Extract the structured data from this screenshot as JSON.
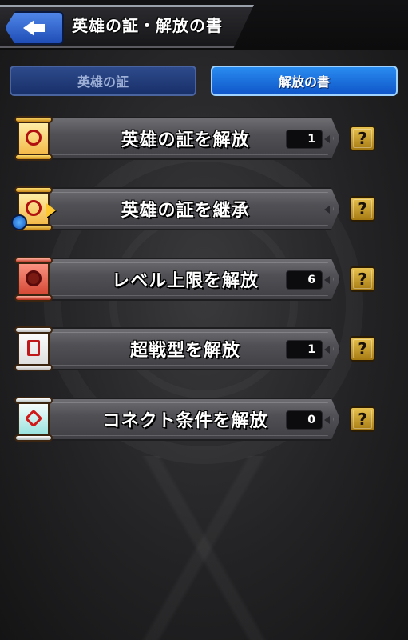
{
  "header": {
    "title": "英雄の証・解放の書"
  },
  "tabs": [
    {
      "label": "英雄の証",
      "active": false
    },
    {
      "label": "解放の書",
      "active": true
    }
  ],
  "rows": [
    {
      "label": "英雄の証を解放",
      "count": "1",
      "icon": "gold-scroll-icon"
    },
    {
      "label": "英雄の証を継承",
      "count": null,
      "icon": "gold-scroll-inherit-icon"
    },
    {
      "label": "レベル上限を解放",
      "count": "6",
      "icon": "red-scroll-icon"
    },
    {
      "label": "超戦型を解放",
      "count": "1",
      "icon": "white-scroll-icon"
    },
    {
      "label": "コネクト条件を解放",
      "count": "0",
      "icon": "teal-scroll-icon"
    }
  ],
  "help_label": "?",
  "colors": {
    "tab_active": "#1a6fe0",
    "tab_inactive": "#203a78",
    "help_button": "#c9a030",
    "row_plate": "#55555a"
  }
}
